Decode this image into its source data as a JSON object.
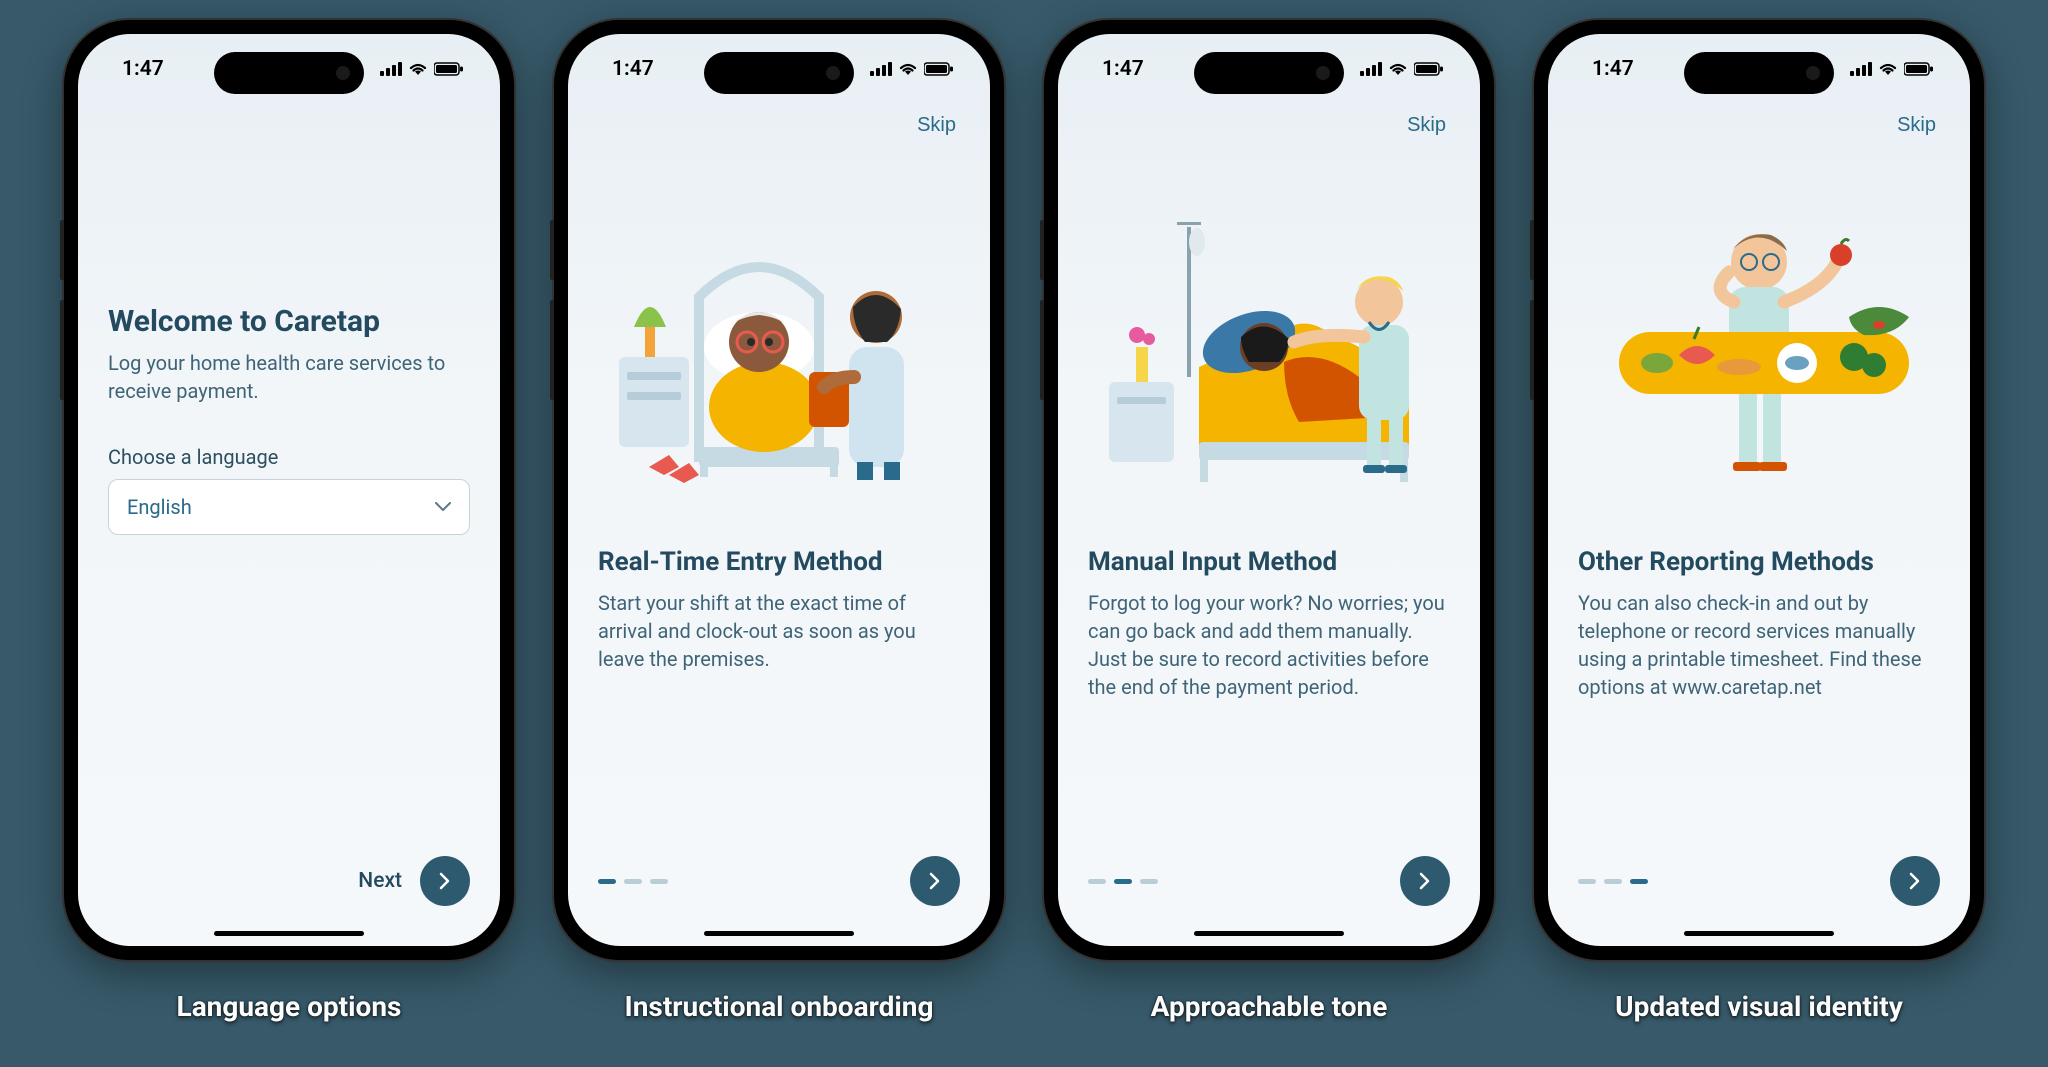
{
  "status_bar": {
    "time": "1:47"
  },
  "screens": [
    {
      "skip": null,
      "title": "Welcome to Caretap",
      "body": "Log your home health care services to receive payment.",
      "choose_label": "Choose a language",
      "language_value": "English",
      "next_label": "Next",
      "dots": null,
      "caption": "Language options"
    },
    {
      "skip": "Skip",
      "title": "Real-Time Entry Method",
      "body": "Start your shift at the exact time of arrival and clock-out as soon as you leave the premises.",
      "dots": {
        "count": 3,
        "active": 0
      },
      "caption": "Instructional onboarding"
    },
    {
      "skip": "Skip",
      "title": "Manual Input Method",
      "body": "Forgot to log your work? No worries; you can go back and add them manually. Just be sure to record activities before the end of the payment period.",
      "dots": {
        "count": 3,
        "active": 1
      },
      "caption": "Approachable tone"
    },
    {
      "skip": "Skip",
      "title": "Other Reporting Methods",
      "body": "You can also check-in and out by telephone or record services manually using a printable timesheet. Find these options at www.caretap.net",
      "dots": {
        "count": 3,
        "active": 2
      },
      "caption": "Updated visual identity"
    }
  ]
}
